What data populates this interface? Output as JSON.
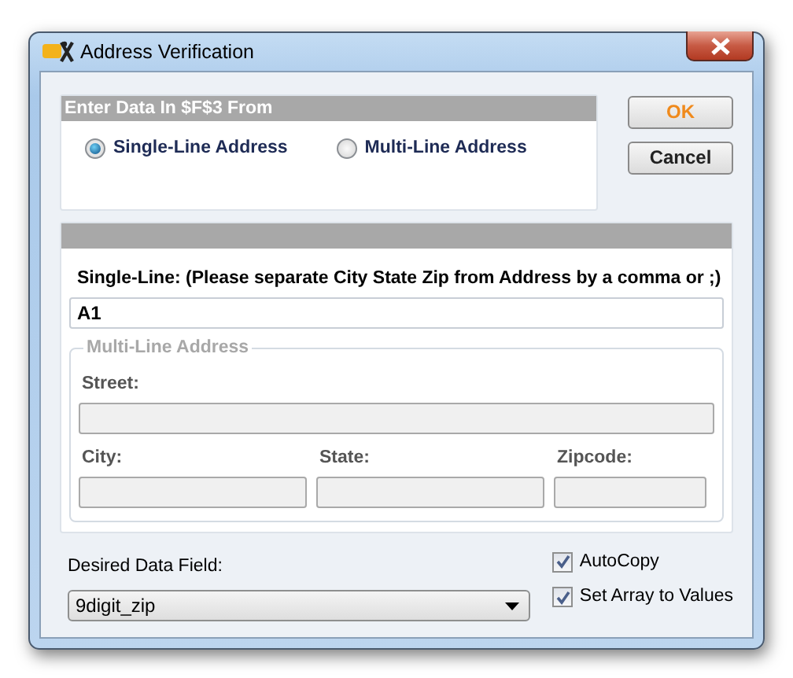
{
  "window": {
    "title": "Address Verification"
  },
  "source_group": {
    "title": "Enter Data In $F$3 From",
    "options": [
      {
        "label": "Single-Line Address",
        "selected": true
      },
      {
        "label": "Multi-Line Address",
        "selected": false
      }
    ]
  },
  "buttons": [
    {
      "label": "OK",
      "kind": "default"
    },
    {
      "label": "Cancel",
      "kind": "normal"
    }
  ],
  "single_line": {
    "label": "Single-Line: (Please separate City State Zip from Address by a comma or ;)",
    "value": "A1"
  },
  "multi_line": {
    "title": "Multi-Line Address",
    "disabled": true,
    "fields": [
      {
        "label": "Street:"
      },
      {
        "label": "City:"
      },
      {
        "label": "State:"
      },
      {
        "label": "Zipcode:"
      }
    ]
  },
  "desired_field": {
    "label": "Desired Data Field:",
    "value": "9digit_zip"
  },
  "checkboxes": [
    {
      "label": "AutoCopy",
      "checked": true
    },
    {
      "label": "Set Array to Values",
      "checked": true
    }
  ]
}
